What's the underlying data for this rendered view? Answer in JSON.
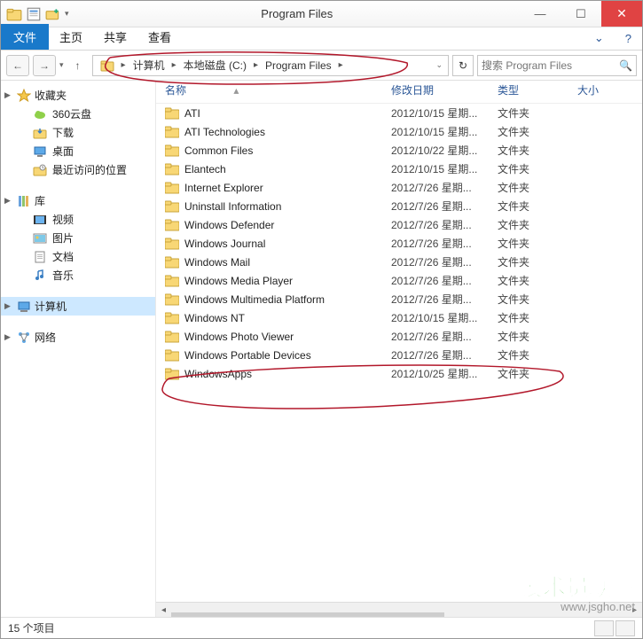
{
  "window": {
    "title": "Program Files"
  },
  "ribbon": {
    "file": "文件",
    "tabs": [
      "主页",
      "共享",
      "查看"
    ]
  },
  "nav": {
    "breadcrumb": [
      "计算机",
      "本地磁盘 (C:)",
      "Program Files"
    ],
    "search_placeholder": "搜索 Program Files"
  },
  "sidebar": {
    "favorites": {
      "label": "收藏夹",
      "items": [
        {
          "label": "360云盘",
          "icon": "cloud"
        },
        {
          "label": "下载",
          "icon": "download"
        },
        {
          "label": "桌面",
          "icon": "desktop"
        },
        {
          "label": "最近访问的位置",
          "icon": "recent"
        }
      ]
    },
    "libraries": {
      "label": "库",
      "items": [
        {
          "label": "视频",
          "icon": "video"
        },
        {
          "label": "图片",
          "icon": "pictures"
        },
        {
          "label": "文档",
          "icon": "documents"
        },
        {
          "label": "音乐",
          "icon": "music"
        }
      ]
    },
    "computer": {
      "label": "计算机"
    },
    "network": {
      "label": "网络"
    }
  },
  "columns": {
    "name": "名称",
    "date": "修改日期",
    "type": "类型",
    "size": "大小"
  },
  "rows": [
    {
      "name": "ATI",
      "date": "2012/10/15 星期...",
      "type": "文件夹"
    },
    {
      "name": "ATI Technologies",
      "date": "2012/10/15 星期...",
      "type": "文件夹"
    },
    {
      "name": "Common Files",
      "date": "2012/10/22 星期...",
      "type": "文件夹"
    },
    {
      "name": "Elantech",
      "date": "2012/10/15 星期...",
      "type": "文件夹"
    },
    {
      "name": "Internet Explorer",
      "date": "2012/7/26 星期...",
      "type": "文件夹"
    },
    {
      "name": "Uninstall Information",
      "date": "2012/7/26 星期...",
      "type": "文件夹"
    },
    {
      "name": "Windows Defender",
      "date": "2012/7/26 星期...",
      "type": "文件夹"
    },
    {
      "name": "Windows Journal",
      "date": "2012/7/26 星期...",
      "type": "文件夹"
    },
    {
      "name": "Windows Mail",
      "date": "2012/7/26 星期...",
      "type": "文件夹"
    },
    {
      "name": "Windows Media Player",
      "date": "2012/7/26 星期...",
      "type": "文件夹"
    },
    {
      "name": "Windows Multimedia Platform",
      "date": "2012/7/26 星期...",
      "type": "文件夹"
    },
    {
      "name": "Windows NT",
      "date": "2012/10/15 星期...",
      "type": "文件夹"
    },
    {
      "name": "Windows Photo Viewer",
      "date": "2012/7/26 星期...",
      "type": "文件夹"
    },
    {
      "name": "Windows Portable Devices",
      "date": "2012/7/26 星期...",
      "type": "文件夹"
    },
    {
      "name": "WindowsApps",
      "date": "2012/10/25 星期...",
      "type": "文件夹"
    }
  ],
  "status": {
    "count_label": "15 个项目"
  },
  "watermark": {
    "line1": "技术员联盟",
    "line2": "www.jsgho.net"
  }
}
